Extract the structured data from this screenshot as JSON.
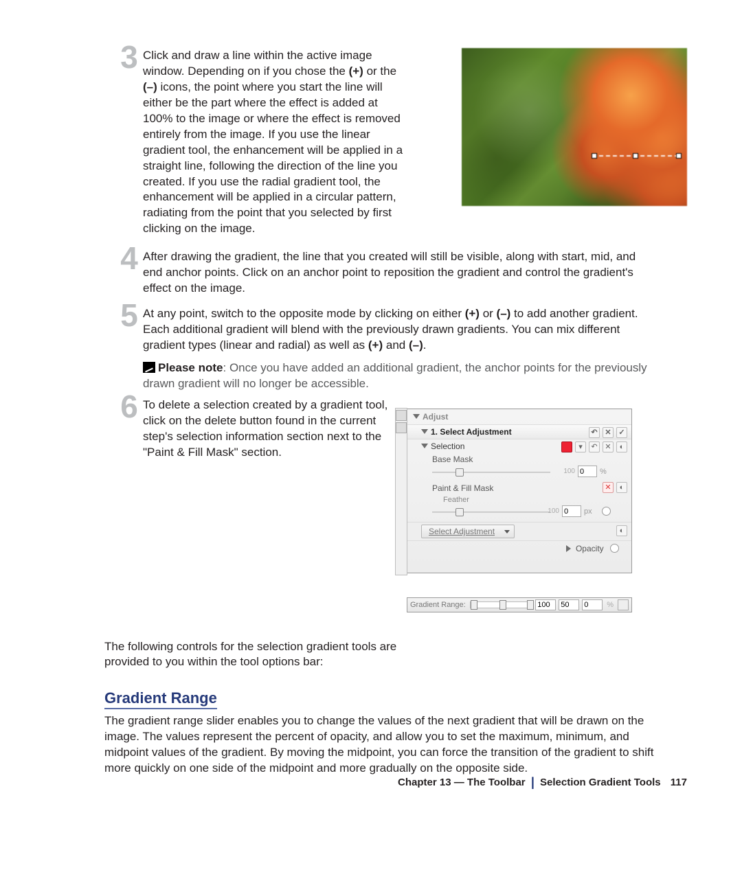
{
  "steps": {
    "s3": {
      "num": "3",
      "t1": "Click and draw a line within the active image window. Depending on if you chose the ",
      "plus": "(+)",
      "t2": " or the ",
      "minus": "(–)",
      "t3": " icons, the point where you start the line will either be the part where the effect is added at 100% to the image or where the effect is removed entirely from the image. If you use the linear gradient tool, the enhancement will be applied in a straight line, following the direction of the line you created. If you use the radial gradient tool, the enhancement will be applied in a circular pattern, radiating from the point that you selected by first clicking on the image."
    },
    "s4": {
      "num": "4",
      "text": "After drawing the gradient, the line that you created will still be visible, along with start, mid, and end anchor points. Click on an anchor point to reposition the gradient and control the gradient's effect on the image."
    },
    "s5": {
      "num": "5",
      "t1": "At any point, switch to the opposite mode by clicking on either ",
      "plus": "(+)",
      "t2": " or ",
      "minus": "(–)",
      "t3": " to add another gradient. Each additional gradient will blend with the previously drawn gradients. You can mix different gradient types (linear and radial) as well as ",
      "plus2": "(+)",
      "t4": " and ",
      "minus2": "(–)",
      "t5": "."
    },
    "note": {
      "label": "Please note",
      "text": ": Once you have added an additional gradient, the anchor points for the previously drawn gradient will no longer be accessible."
    },
    "s6": {
      "num": "6",
      "text": "To delete a selection created by a gradient tool, click on the delete button found in the current step's selection information section next to the \"Paint & Fill Mask\" section."
    }
  },
  "panel": {
    "adjust": "Adjust",
    "sel_adj_title": "1. Select Adjustment",
    "selection": "Selection",
    "base_mask": "Base Mask",
    "paint_fill": "Paint & Fill Mask",
    "feather": "Feather",
    "select_adj_btn": "Select Adjustment",
    "opacity": "Opacity",
    "val_base": "0",
    "scale_base": "100",
    "unit_pct": "%",
    "val_feather": "0",
    "scale_feather": "100",
    "unit_px": "px"
  },
  "optbar": {
    "label": "Gradient Range:",
    "v1": "100",
    "v2": "50",
    "v3": "0",
    "pct": "%"
  },
  "following": "The following controls for the selection gradient tools are provided to you within the tool options bar:",
  "heading": "Gradient Range",
  "desc": "The gradient range slider enables you to change the values of the next gradient that will be drawn on the image. The values represent the percent of opacity, and allow you to set the maximum, minimum, and midpoint values of the gradient. By moving the midpoint, you can force the transition of the gradient to shift more quickly on one side of the midpoint and more gradually on the opposite side.",
  "footer": {
    "chapter": "Chapter 13 — The Toolbar",
    "section": "Selection Gradient Tools",
    "page": "117"
  }
}
